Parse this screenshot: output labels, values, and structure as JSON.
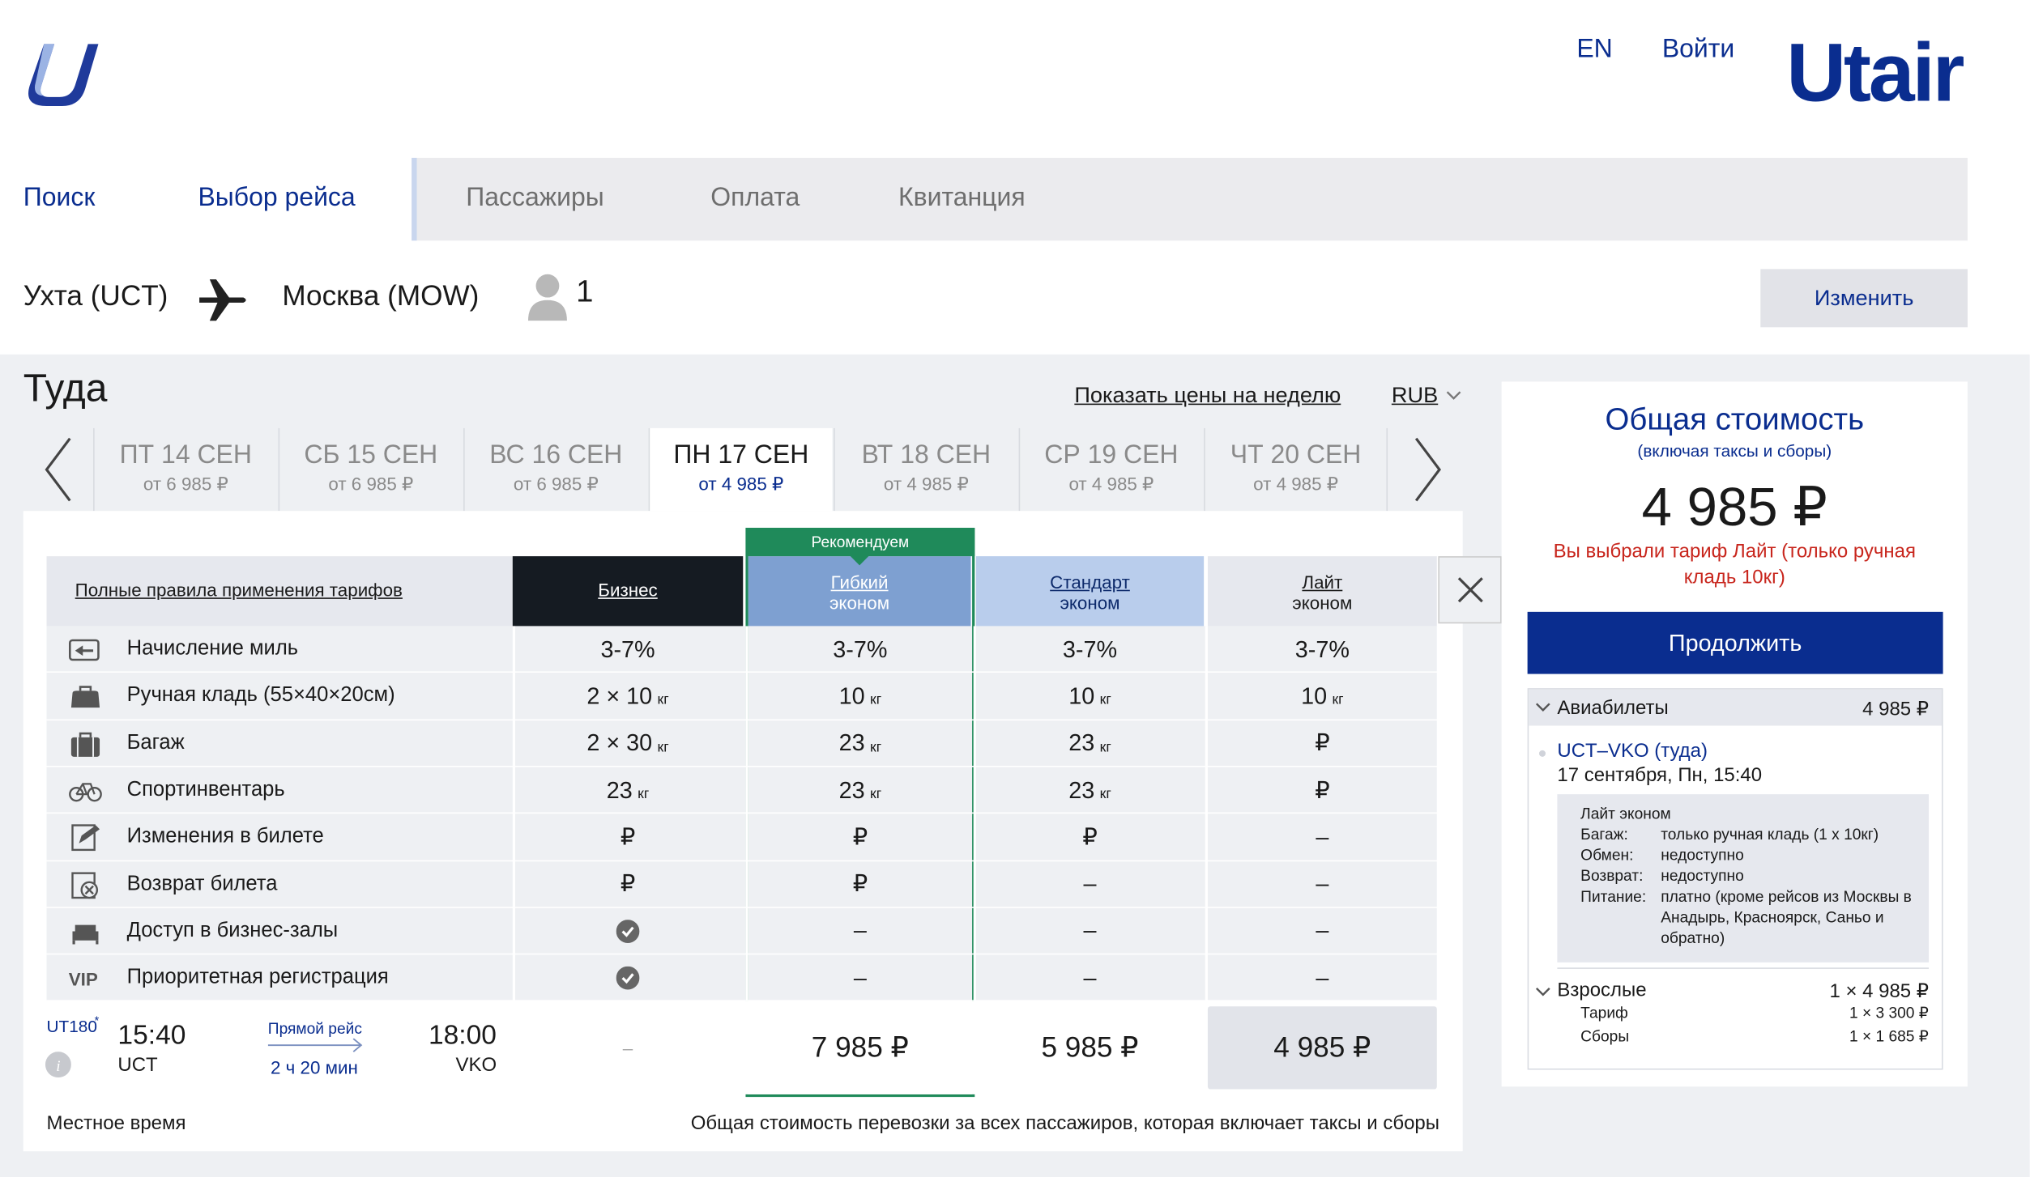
{
  "header": {
    "lang": "EN",
    "login": "Войти",
    "brand": "Utair"
  },
  "steps": [
    "Поиск",
    "Выбор рейса",
    "Пассажиры",
    "Оплата",
    "Квитанция"
  ],
  "route": {
    "from": "Ухта (UCT)",
    "to": "Москва (MOW)",
    "passengers": "1",
    "change_label": "Изменить"
  },
  "direction_title": "Туда",
  "week_prices_link": "Показать цены на неделю",
  "currency": "RUB",
  "dates": [
    {
      "day": "ПТ 14 СЕН",
      "price": "от 6 985 ₽"
    },
    {
      "day": "СБ 15 СЕН",
      "price": "от 6 985 ₽"
    },
    {
      "day": "ВС 16 СЕН",
      "price": "от 6 985 ₽"
    },
    {
      "day": "ПН 17 СЕН",
      "price": "от 4 985 ₽"
    },
    {
      "day": "ВТ 18 СЕН",
      "price": "от 4 985 ₽"
    },
    {
      "day": "СР 19 СЕН",
      "price": "от 4 985 ₽"
    },
    {
      "day": "ЧТ 20 СЕН",
      "price": "от 4 985 ₽"
    }
  ],
  "fares": {
    "rules_link": "Полные правила применения тарифов",
    "recommended": "Рекомендуем",
    "columns": [
      {
        "name": "Бизнес",
        "sub": ""
      },
      {
        "name": "Гибкий",
        "sub": "эконом"
      },
      {
        "name": "Стандарт",
        "sub": "эконом"
      },
      {
        "name": "Лайт",
        "sub": "эконом"
      }
    ],
    "rows": [
      {
        "label": "Начисление миль",
        "icon": "miles-icon",
        "values": [
          "3-7%",
          "3-7%",
          "3-7%",
          "3-7%"
        ]
      },
      {
        "label": "Ручная кладь (55×40×20см)",
        "icon": "hand-luggage-icon",
        "values": [
          "2 × 10",
          "10",
          "10",
          "10"
        ],
        "unit": "кг"
      },
      {
        "label": "Багаж",
        "icon": "baggage-icon",
        "values": [
          "2 × 30",
          "23",
          "23",
          "₽"
        ],
        "unit": "кг"
      },
      {
        "label": "Спортинвентарь",
        "icon": "bike-icon",
        "values": [
          "23",
          "23",
          "23",
          "₽"
        ],
        "unit": "кг"
      },
      {
        "label": "Изменения в билете",
        "icon": "edit-ticket-icon",
        "values": [
          "₽",
          "₽",
          "₽",
          "–"
        ]
      },
      {
        "label": "Возврат билета",
        "icon": "refund-icon",
        "values": [
          "₽",
          "₽",
          "–",
          "–"
        ]
      },
      {
        "label": "Доступ в бизнес-залы",
        "icon": "lounge-icon",
        "values": [
          "check",
          "–",
          "–",
          "–"
        ]
      },
      {
        "label": "Приоритетная регистрация",
        "icon": "vip-icon",
        "values": [
          "check",
          "–",
          "–",
          "–"
        ]
      }
    ]
  },
  "flight": {
    "number": "UT180",
    "dep_time": "15:40",
    "dep_code": "UCT",
    "direct": "Прямой рейс",
    "duration": "2 ч 20 мин",
    "arr_time": "18:00",
    "arr_code": "VKO",
    "prices": [
      "–",
      "7 985 ₽",
      "5 985 ₽",
      "4 985 ₽"
    ]
  },
  "footer": {
    "local_time": "Местное время",
    "note": "Общая стоимость перевозки за всех пассажиров, которая включает таксы и сборы"
  },
  "summary": {
    "title": "Общая стоимость",
    "subtitle": "(включая таксы и сборы)",
    "total": "4 985 ₽",
    "warning": "Вы выбрали тариф Лайт (только ручная кладь 10кг)",
    "continue": "Продолжить",
    "tickets_label": "Авиабилеты",
    "tickets_total": "4 985 ₽",
    "segment": "UCT–VKO (туда)",
    "segment_date": "17 сентября, Пн, 15:40",
    "details_title": "Лайт эконом",
    "details": [
      {
        "k": "Багаж:",
        "v": "только ручная кладь (1 x 10кг)"
      },
      {
        "k": "Обмен:",
        "v": "недоступно"
      },
      {
        "k": "Возврат:",
        "v": "недоступно"
      },
      {
        "k": "Питание:",
        "v": "платно (кроме рейсов из Москвы в Анадырь, Красноярск, Саньо и обратно)"
      }
    ],
    "adults_label": "Взрослые",
    "adults_value": "1 × 4 985 ₽",
    "tariff_label": "Тариф",
    "tariff_value": "1 × 3 300 ₽",
    "fees_label": "Сборы",
    "fees_value": "1 × 1 685 ₽"
  }
}
